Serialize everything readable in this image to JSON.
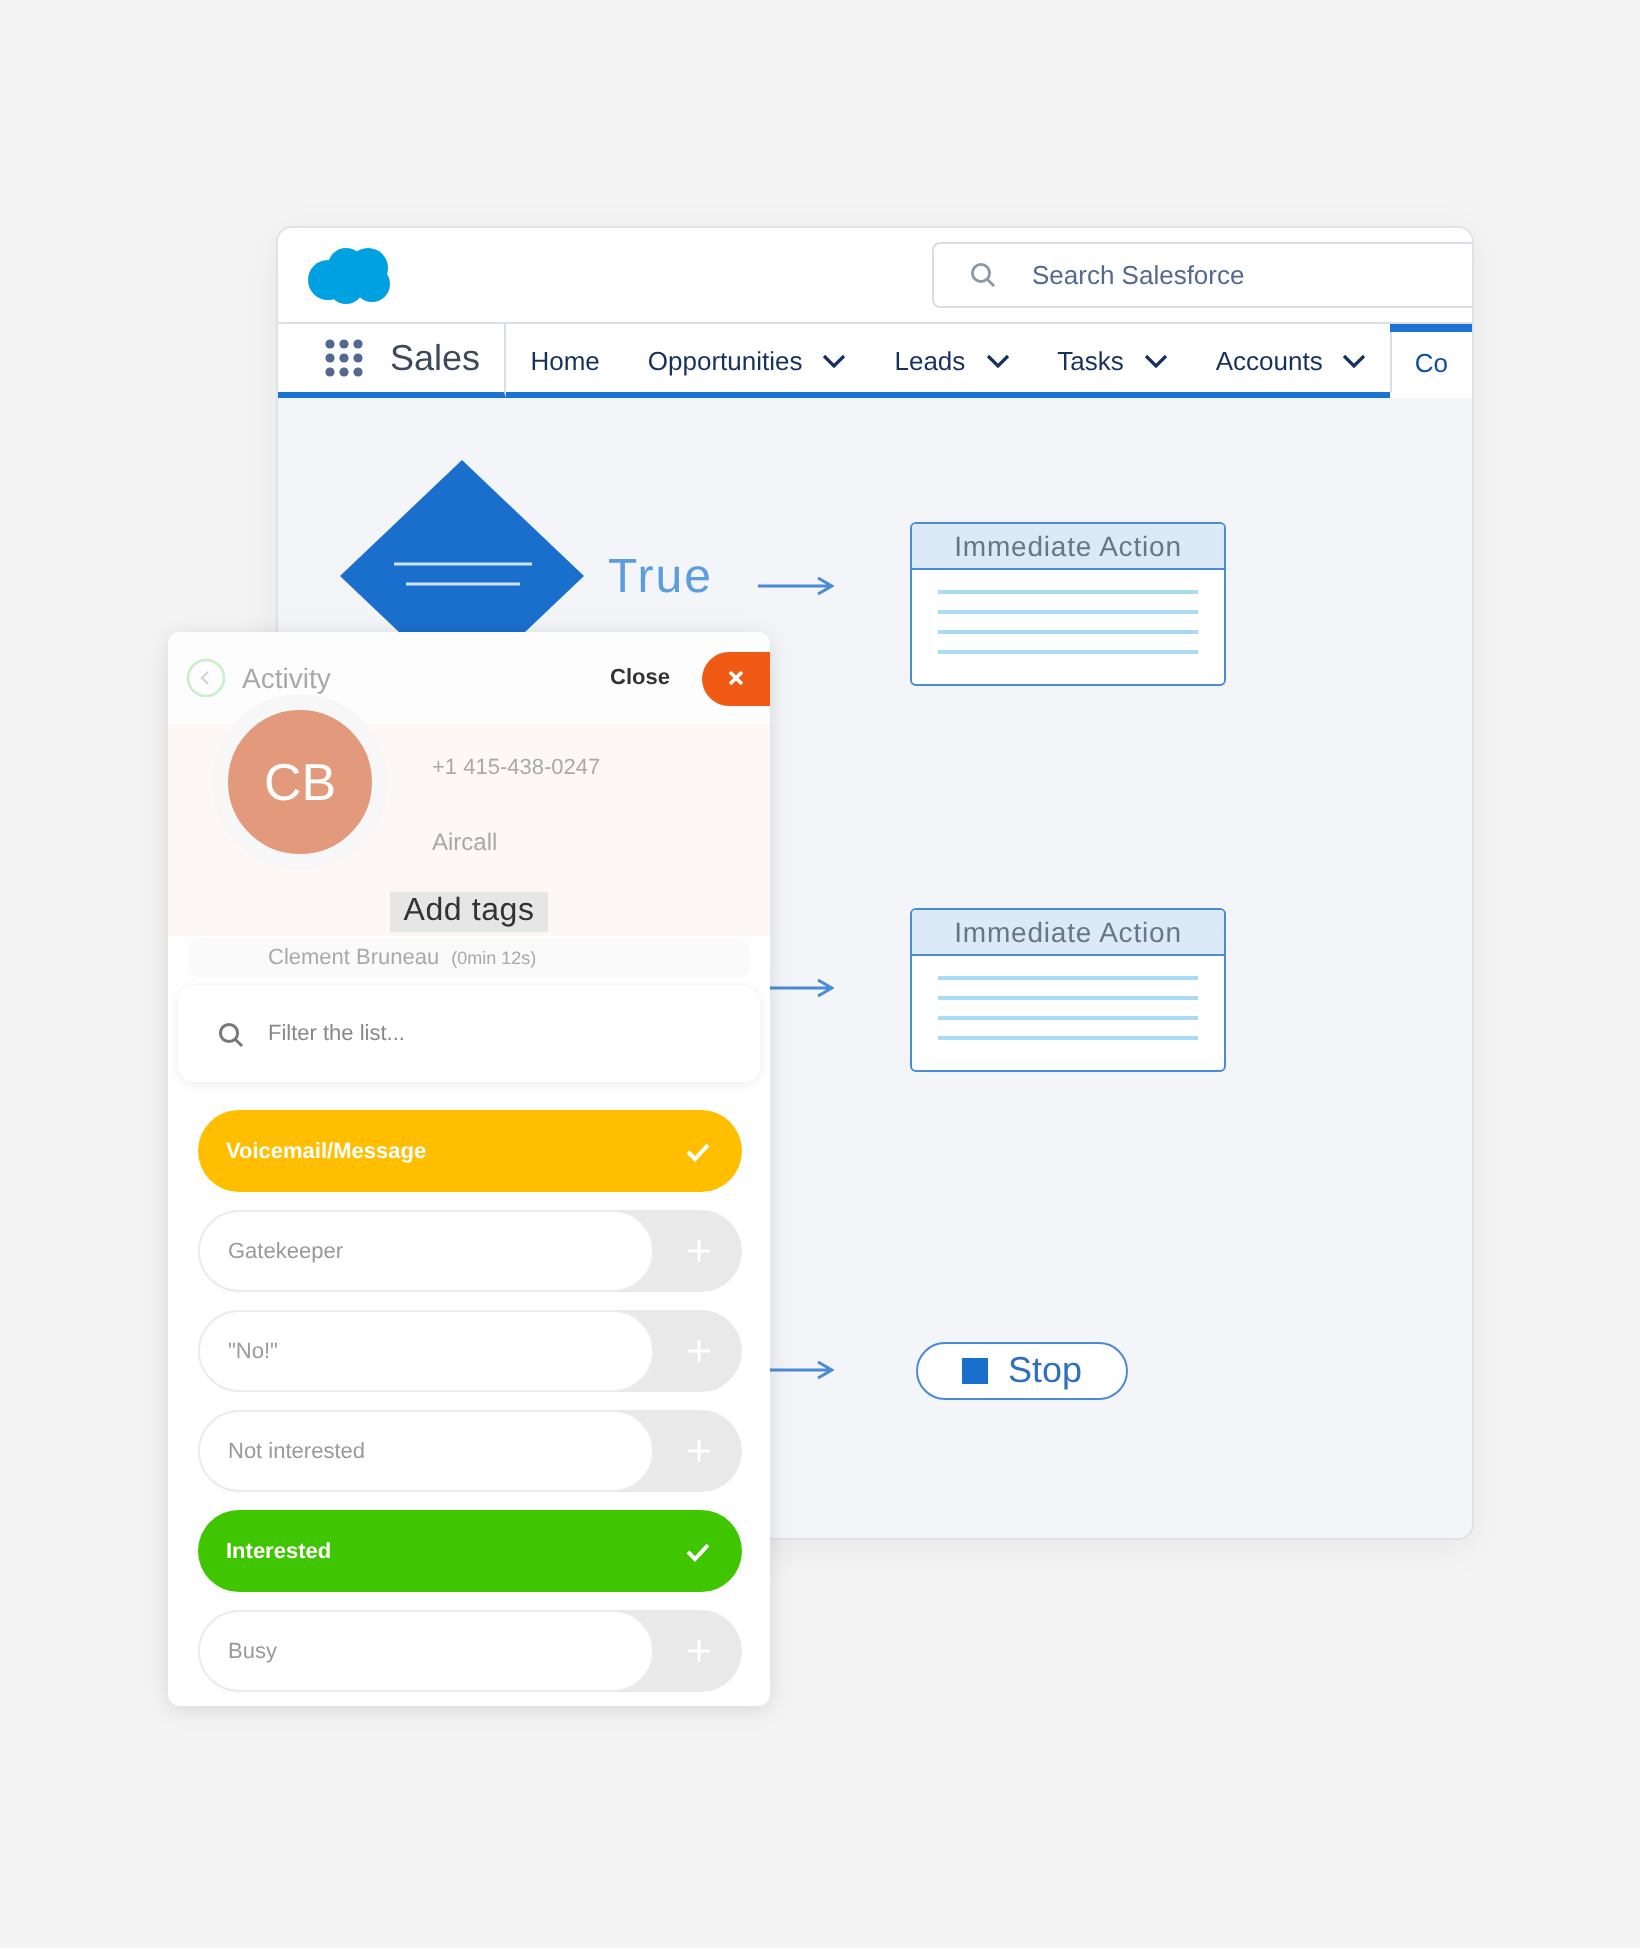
{
  "salesforce_window": {
    "search": {
      "placeholder": "Search Salesforce"
    },
    "app_name": "Sales",
    "tabs": [
      {
        "label": "Home",
        "has_menu": false,
        "selected": false
      },
      {
        "label": "Opportunities",
        "has_menu": true,
        "selected": false
      },
      {
        "label": "Leads",
        "has_menu": true,
        "selected": false
      },
      {
        "label": "Tasks",
        "has_menu": true,
        "selected": false
      },
      {
        "label": "Accounts",
        "has_menu": true,
        "selected": false
      },
      {
        "label": "Co",
        "has_menu": false,
        "selected": true
      }
    ],
    "flow": {
      "condition_label": "True",
      "nodes": [
        {
          "kind": "action",
          "title": "Immediate Action"
        },
        {
          "kind": "action",
          "title": "Immediate Action"
        },
        {
          "kind": "stop",
          "label": "Stop"
        }
      ]
    }
  },
  "activity_panel": {
    "title": "Activity",
    "close_label": "Close",
    "contact": {
      "initials": "CB",
      "phone": "+1 415-438-0247",
      "company": "Aircall"
    },
    "call": {
      "name": "Clement Bruneau",
      "duration": "(0min 12s)"
    },
    "tags_title": "Add tags",
    "filter": {
      "placeholder": "Filter the list..."
    },
    "tags": [
      {
        "label": "Voicemail/Message",
        "selected": true,
        "color": "#ffbe00"
      },
      {
        "label": "Gatekeeper",
        "selected": false
      },
      {
        "label": "\"No!\"",
        "selected": false
      },
      {
        "label": "Not interested",
        "selected": false
      },
      {
        "label": "Interested",
        "selected": true,
        "color": "#3fc600"
      },
      {
        "label": "Busy",
        "selected": false
      }
    ]
  }
}
